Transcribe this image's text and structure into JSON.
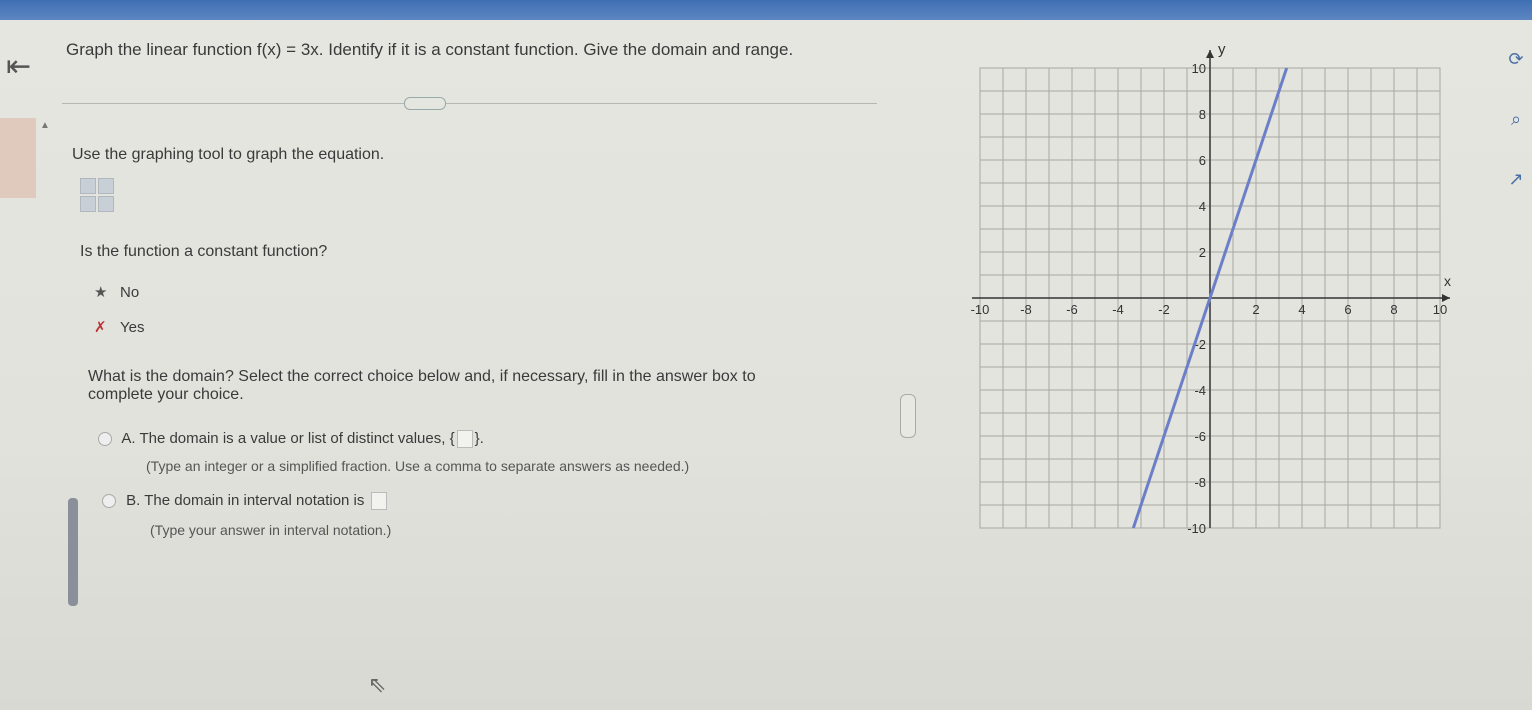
{
  "question": {
    "prefix": "Graph the linear function ",
    "function": "f(x) = 3x",
    "suffix": ". Identify if it is a constant function. Give the domain and range."
  },
  "instruction": "Use the graphing tool to graph the equation.",
  "constant_question": "Is the function a constant function?",
  "constant_options": [
    {
      "label": "No",
      "mark": "★"
    },
    {
      "label": "Yes",
      "mark": "✗"
    }
  ],
  "domain_question": "What is the domain? Select the correct choice below and, if necessary, fill in the answer box to complete your choice.",
  "choice_a": {
    "letter": "A.",
    "text": "The domain is a value or list of distinct values,",
    "hint": "(Type an integer or a simplified fraction. Use a comma to separate answers as needed.)"
  },
  "choice_b": {
    "letter": "B.",
    "text": "The domain in interval notation is",
    "hint": "(Type your answer in interval notation.)"
  },
  "graph": {
    "x_label": "x",
    "y_label": "y",
    "x_ticks": [
      "-10",
      "-8",
      "-6",
      "-4",
      "-2",
      "2",
      "4",
      "6",
      "8",
      "10"
    ],
    "y_ticks": [
      "10",
      "8",
      "6",
      "4",
      "2",
      "-2",
      "-4",
      "-6",
      "-8",
      "-10"
    ],
    "line_color": "#6b7fc8",
    "xlim": [
      -10,
      10
    ],
    "ylim": [
      -10,
      10
    ]
  },
  "icons": {
    "back": "back-arrow-icon",
    "tool": "graph-tool-icon",
    "right": [
      "refresh-icon",
      "search-icon",
      "external-link-icon"
    ]
  }
}
